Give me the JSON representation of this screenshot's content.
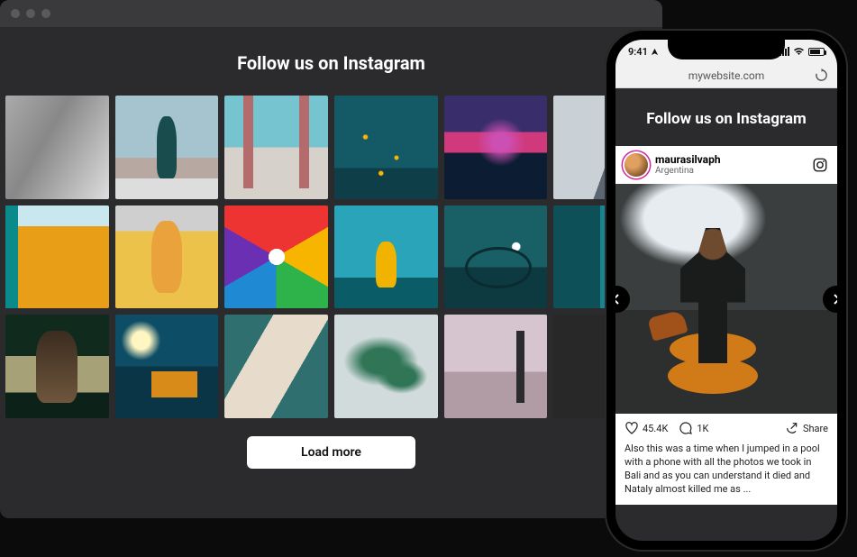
{
  "desktop": {
    "heading": "Follow us on Instagram",
    "load_more_label": "Load more",
    "thumbs": [
      "friends-bw",
      "palm-crosswalk",
      "sitting-street",
      "city-aerial-cabs",
      "pink-smoke-sunset",
      "cliff-climber",
      "yellow-wall",
      "yellow-jacket-pose",
      "rainbow-mural",
      "yellow-hoodie-sea",
      "girl-bicycle",
      "dark-teal-portrait",
      "brunette-jacket",
      "boat-horizon",
      "ocean-foam",
      "big-leaves",
      "skyline-tower",
      "hidden-thumb"
    ]
  },
  "phone": {
    "status_time": "9:41",
    "url": "mywebsite.com",
    "heading": "Follow us on Instagram",
    "post": {
      "username": "maurasilvaph",
      "location": "Argentina",
      "likes": "45.4K",
      "comments": "1K",
      "share_label": "Share",
      "caption": "Also this was a time when I jumped in a pool with a phone with all the photos we took in Bali and as you can understand it died and Nataly almost killed me as ..."
    }
  }
}
